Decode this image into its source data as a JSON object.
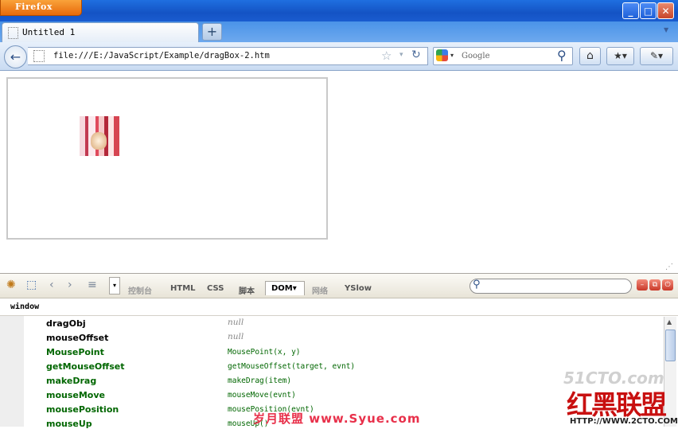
{
  "browser": {
    "app_button_label": "Firefox",
    "window_buttons": {
      "minimize": "_",
      "maximize": "□",
      "close": "✕"
    },
    "tabs": [
      {
        "title": "Untitled 1"
      }
    ],
    "new_tab_label": "+",
    "url": "file:///E:/JavaScript/Example/dragBox-2.htm",
    "search_placeholder": "Google",
    "icons": {
      "back": "←",
      "star": "☆",
      "dropmarker": "▾",
      "reload": "↻",
      "search": "⚲",
      "home": "⌂",
      "bookmarks": "★▾",
      "addon": "✎▾"
    }
  },
  "firebug": {
    "tabs": [
      {
        "label": "控制台",
        "active": false,
        "enabled": false
      },
      {
        "label": "HTML",
        "active": false,
        "enabled": true
      },
      {
        "label": "CSS",
        "active": false,
        "enabled": true
      },
      {
        "label": "脚本",
        "active": false,
        "enabled": true
      },
      {
        "label": "DOM▾",
        "active": true,
        "enabled": true
      },
      {
        "label": "网络",
        "active": false,
        "enabled": false
      },
      {
        "label": "YSlow",
        "active": false,
        "enabled": true
      }
    ],
    "path": "window",
    "properties": [
      {
        "name": "dragObj",
        "value": "null",
        "kind": "object"
      },
      {
        "name": "mouseOffset",
        "value": "null",
        "kind": "object"
      },
      {
        "name": "MousePoint",
        "value": "MousePoint(x, y)",
        "kind": "function"
      },
      {
        "name": "getMouseOffset",
        "value": "getMouseOffset(target, evnt)",
        "kind": "function"
      },
      {
        "name": "makeDrag",
        "value": "makeDrag(item)",
        "kind": "function"
      },
      {
        "name": "mouseMove",
        "value": "mouseMove(evnt)",
        "kind": "function"
      },
      {
        "name": "mousePosition",
        "value": "mousePosition(evnt)",
        "kind": "function"
      },
      {
        "name": "mouseUp",
        "value": "mouseUp()",
        "kind": "function"
      }
    ]
  },
  "watermarks": {
    "site_51cto": "51CTO.com",
    "hongxia": "红黑联盟",
    "url_2cto": "HTTP://WWW.2CTO.COM",
    "syue": "岁月联盟  www.Syue.com"
  },
  "colors": {
    "accent": "#1453c4",
    "function_green": "#006600",
    "watermark_red": "#c81010"
  }
}
